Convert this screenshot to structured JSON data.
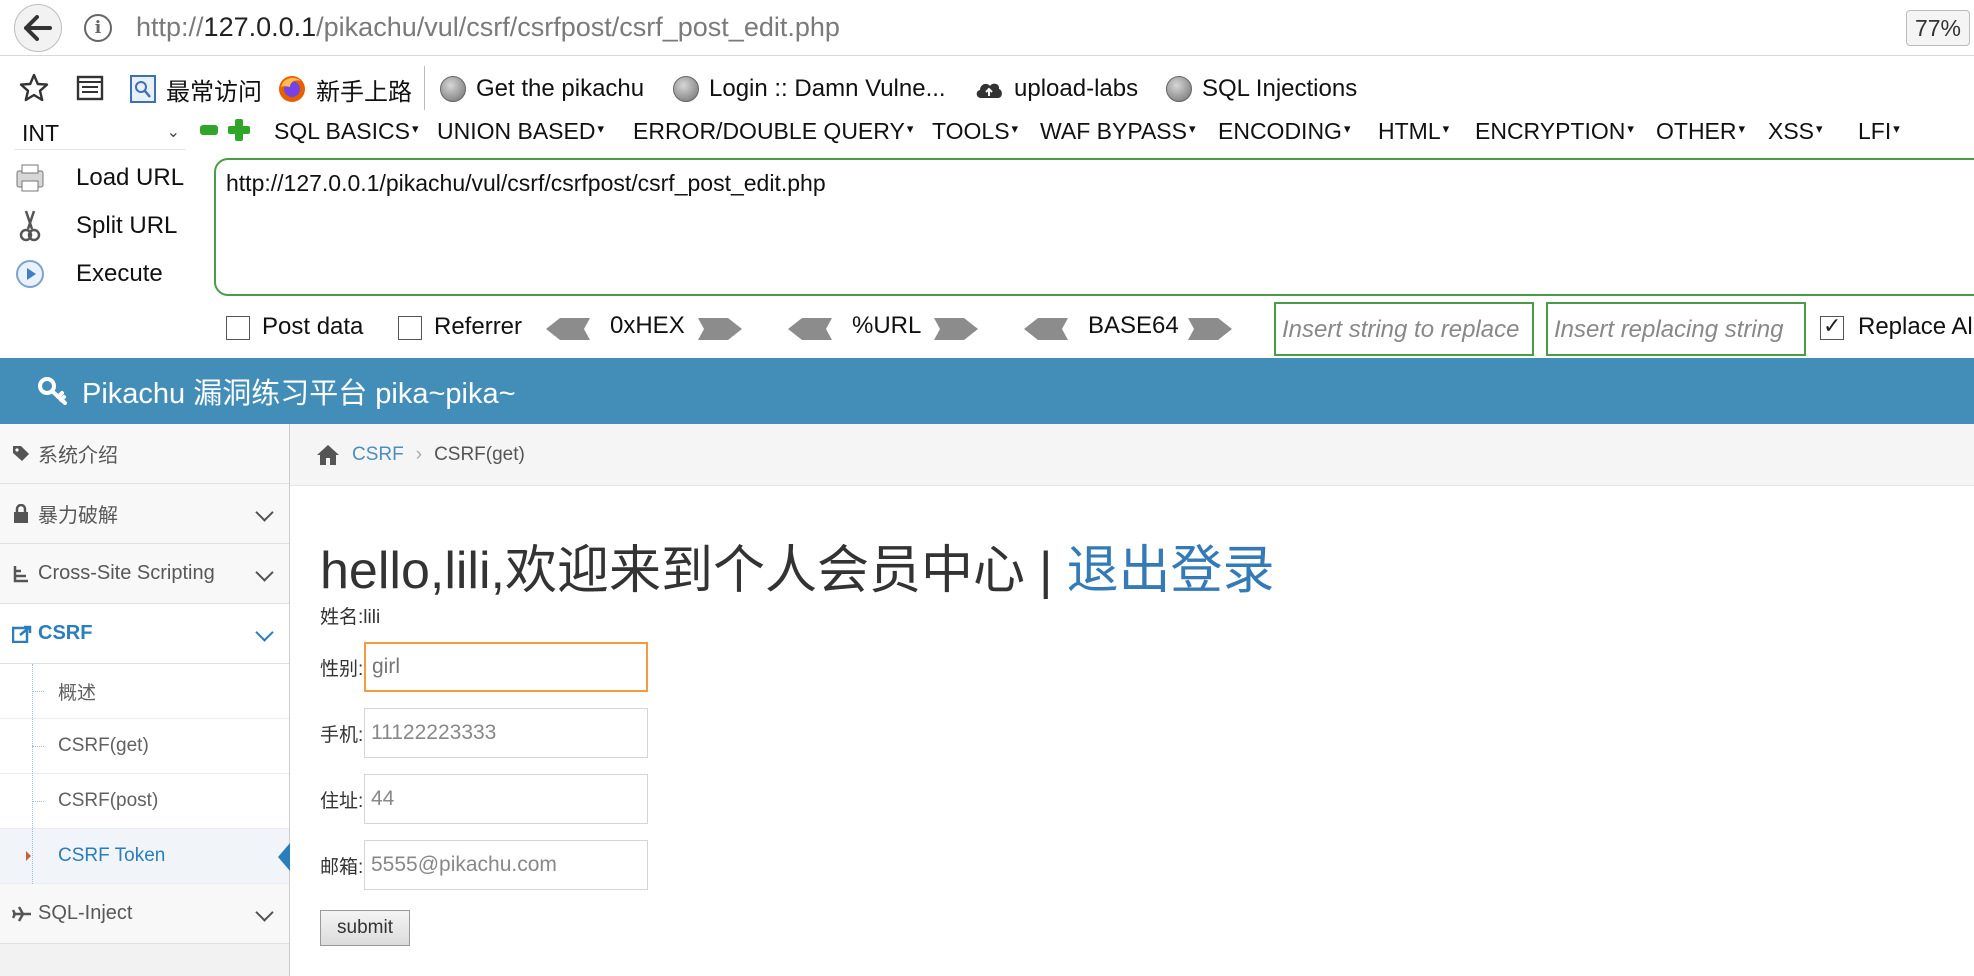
{
  "browser": {
    "url_prefix": "http://",
    "url_host": "127.0.0.1",
    "url_path": "/pikachu/vul/csrf/csrfpost/csrf_post_edit.php",
    "zoom": "77%",
    "bookmarks": [
      {
        "label": "最常访问",
        "icon": "bookmark-page-icon"
      },
      {
        "label": "新手上路",
        "icon": "firefox-icon"
      },
      {
        "label": "Get the pikachu",
        "icon": "globe-icon"
      },
      {
        "label": "Login :: Damn Vulne...",
        "icon": "globe-icon"
      },
      {
        "label": "upload-labs",
        "icon": "cloud-icon"
      },
      {
        "label": "SQL Injections",
        "icon": "globe-icon"
      }
    ]
  },
  "hackbar": {
    "select_value": "INT",
    "menu": [
      "SQL BASICS",
      "UNION BASED",
      "ERROR/DOUBLE QUERY",
      "TOOLS",
      "WAF BYPASS",
      "ENCODING",
      "HTML",
      "ENCRYPTION",
      "OTHER",
      "XSS",
      "LFI"
    ],
    "load_url": "Load URL",
    "split_url": "Split URL",
    "execute": "Execute",
    "url_value": "http://127.0.0.1/pikachu/vul/csrf/csrfpost/csrf_post_edit.php",
    "post_data": "Post data",
    "referrer": "Referrer",
    "hex": "0xHEX",
    "url_enc": "%URL",
    "base64": "BASE64",
    "replace_placeholder": "Insert string to replace",
    "replacing_placeholder": "Insert replacing string",
    "replace_all": "Replace All"
  },
  "app": {
    "title": "Pikachu 漏洞练习平台 pika~pika~",
    "sidebar": [
      {
        "label": "系统介绍",
        "icon": "tags-icon",
        "expandable": false
      },
      {
        "label": "暴力破解",
        "icon": "lock-icon",
        "expandable": true
      },
      {
        "label": "Cross-Site Scripting",
        "icon": "tree-icon",
        "expandable": true
      },
      {
        "label": "CSRF",
        "icon": "share-icon",
        "expandable": true,
        "active": true
      },
      {
        "label": "SQL-Inject",
        "icon": "plane-icon",
        "expandable": true
      }
    ],
    "csrf_sub": [
      "概述",
      "CSRF(get)",
      "CSRF(post)",
      "CSRF Token"
    ],
    "breadcrumb": {
      "section": "CSRF",
      "page": "CSRF(get)"
    },
    "greeting": "hello,lili,欢迎来到个人会员中心",
    "divider": "|",
    "logout": "退出登录",
    "name_line": "姓名:lili",
    "form": {
      "sex_label": "性别:",
      "sex_value": "girl",
      "phone_label": "手机:",
      "phone_value": "11122223333",
      "address_label": "住址:",
      "address_value": "44",
      "email_label": "邮箱:",
      "email_value": "5555@pikachu.com",
      "submit": "submit"
    }
  }
}
